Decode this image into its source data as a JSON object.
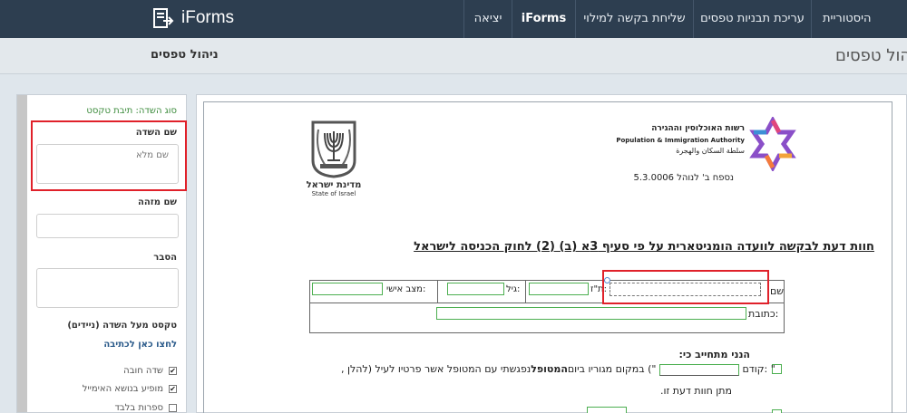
{
  "nav": {
    "logo_text": "iForms",
    "items": [
      "היסטוריית טפסים",
      "עריכת תבניות טפסים",
      "שליחת בקשה למילוי",
      "iForms",
      "יציאה"
    ]
  },
  "subheader": {
    "section_title": "ניהול טפסים",
    "page_title": "הול טפסים"
  },
  "panel": {
    "field_type": "סוג השדה: תיבת טקסט",
    "field_name_label": "שם השדה",
    "field_name_value": "שם מלא",
    "identifier_label": "שם מזהה",
    "explanation_label": "הסבר",
    "text_above_label": "טקסט מעל השדה (ניידים)",
    "click_to_write": "לחצו כאן לכתיבה",
    "checkboxes": [
      {
        "label": "שדה חובה",
        "checked": true
      },
      {
        "label": "מופיע בנושא האימייל",
        "checked": true
      },
      {
        "label": "ספרות בלבד",
        "checked": false
      }
    ]
  },
  "form": {
    "state_name_he": "מדינת ישראל",
    "state_name_en": "State of Israel",
    "authority_he": "רשות האוכלוסין וההגירה",
    "authority_en": "Population & Immigration Authority",
    "authority_ar": "سلطة السكان والهجرة",
    "appendix": "נספח ב' לנוהל 5.3.0006",
    "heading": "חוות דעת לבקשה לוועדה הומניטארית על פי סעיף 3א (ב) (2) לחוק הכניסה לישראל",
    "row1": {
      "name": "שם",
      "id": "ת\"ז:",
      "age": "גיל:",
      "marital": "מצב אישי:"
    },
    "address": "כתובת:",
    "committed": "הנני מתחייב כי:",
    "line1a": "נפגשתי עם המטופל אשר פרטיו לעיל (להלן: \"",
    "line1b": "המטופל",
    "line1c": "\") במקום מגוריו ביום",
    "line1d": ", קודם",
    "line2": "מתן חוות דעת זו."
  },
  "colors": {
    "navbar": "#2d3e50",
    "highlight": "#e0212a",
    "field_border": "#4caf50"
  }
}
